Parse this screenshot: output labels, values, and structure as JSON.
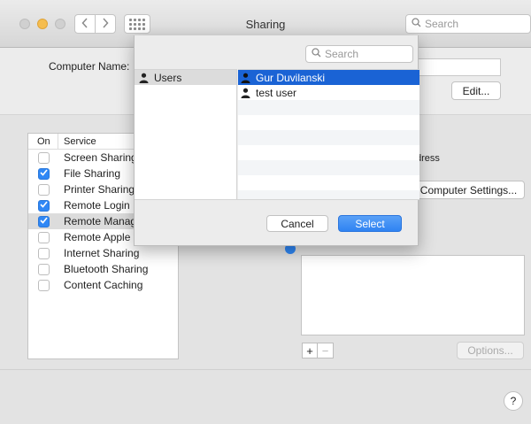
{
  "window": {
    "title": "Sharing",
    "search_placeholder": "Search"
  },
  "computer": {
    "name_label": "Computer Name:",
    "edit_label": "Edit..."
  },
  "services": {
    "col_on": "On",
    "col_service": "Service",
    "items": [
      {
        "label": "Screen Sharing",
        "checked": false
      },
      {
        "label": "File Sharing",
        "checked": true
      },
      {
        "label": "Printer Sharing",
        "checked": false
      },
      {
        "label": "Remote Login",
        "checked": true
      },
      {
        "label": "Remote Management",
        "checked": true
      },
      {
        "label": "Remote Apple Events",
        "checked": false
      },
      {
        "label": "Internet Sharing",
        "checked": false
      },
      {
        "label": "Bluetooth Sharing",
        "checked": false
      },
      {
        "label": "Content Caching",
        "checked": false
      }
    ]
  },
  "right": {
    "address_fragment": "dress",
    "computer_settings_label": "Computer Settings...",
    "options_label": "Options...",
    "plus_label": "+",
    "minus_label": "−",
    "help_label": "?"
  },
  "sheet": {
    "search_placeholder": "Search",
    "source": {
      "label": "Users"
    },
    "users": [
      {
        "name": "Gur Duvilanski",
        "selected": true
      },
      {
        "name": "test user",
        "selected": false
      }
    ],
    "cancel_label": "Cancel",
    "select_label": "Select"
  },
  "colors": {
    "accent": "#2f87f5",
    "selection": "#1a63d5"
  }
}
